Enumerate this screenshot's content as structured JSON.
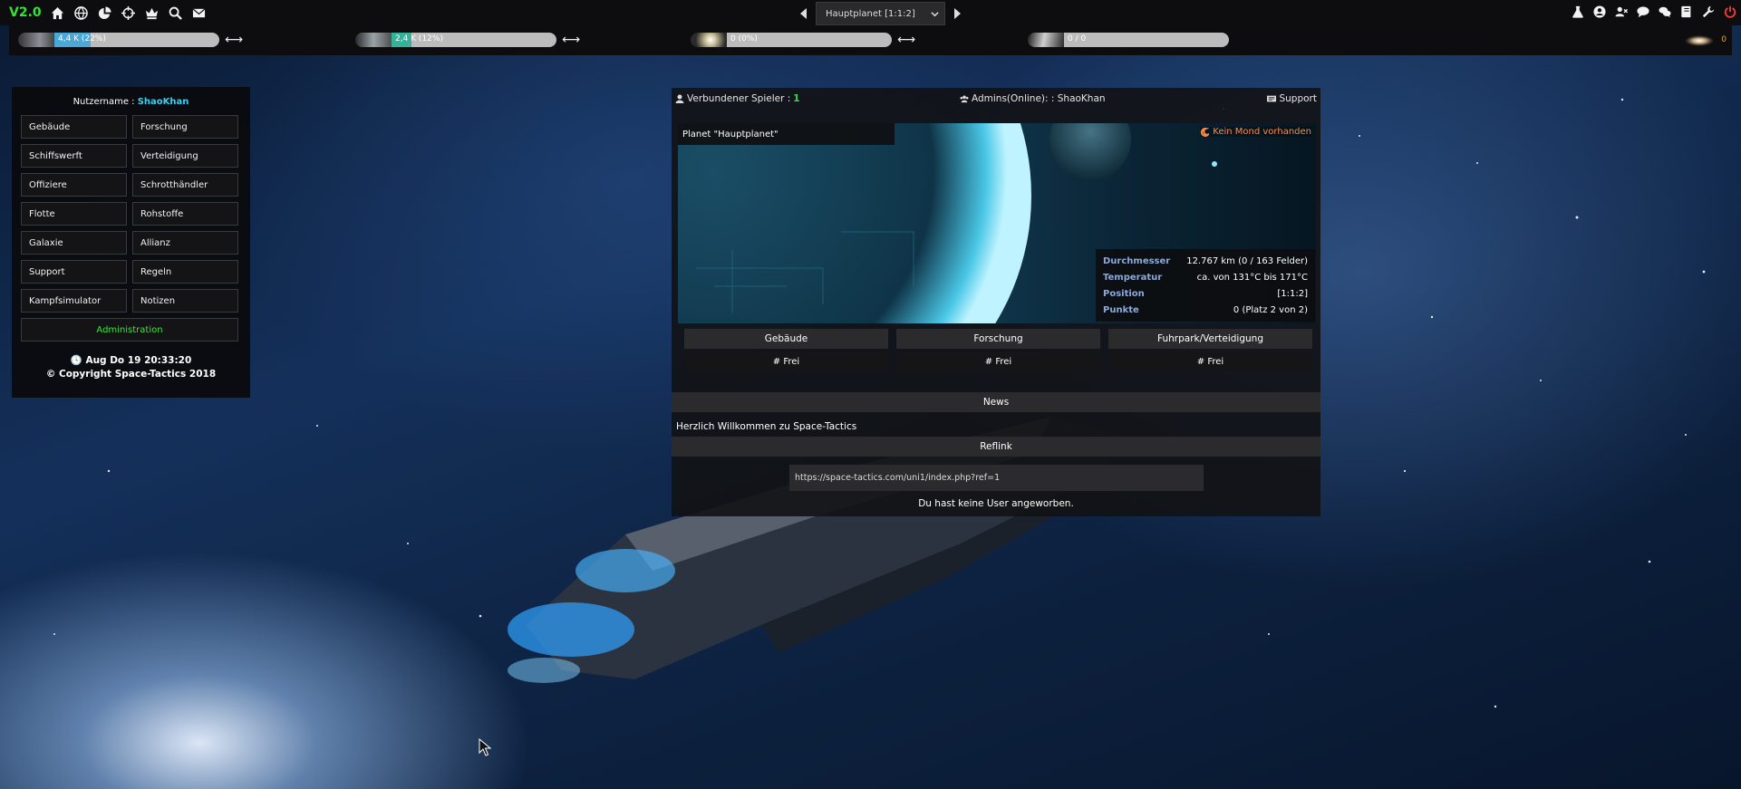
{
  "topbar": {
    "version": "V2.0",
    "left_icons": [
      "home-icon",
      "globe-icon",
      "pie-chart-icon",
      "crosshair-icon",
      "crown-icon",
      "search-icon",
      "envelope-icon"
    ],
    "planet_selector": "Hauptplanet [1:1:2]",
    "right_icons": [
      "flask-icon",
      "user-circle-icon",
      "user-remove-icon",
      "comment-icon",
      "comments-icon",
      "book-icon",
      "wrench-icon",
      "power-icon"
    ]
  },
  "resources": [
    {
      "label": "4,4 K (22%)",
      "fill": 0.22,
      "color": "#4aa8d6"
    },
    {
      "label": "2,4 K (12%)",
      "fill": 0.12,
      "color": "#35b39a"
    },
    {
      "label": "0 (0%)",
      "fill": 0.0,
      "color": "#cccccc"
    },
    {
      "label": "0  / 0",
      "fill": 0.0,
      "color": "#cccccc"
    }
  ],
  "galaxy_value": "0",
  "left_menu": {
    "username_label": "Nutzername :",
    "username": "ShaoKhan",
    "items": [
      "Gebäude",
      "Forschung",
      "Schiffswerft",
      "Verteidigung",
      "Offiziere",
      "Schrotthändler",
      "Flotte",
      "Rohstoffe",
      "Galaxie",
      "Allianz",
      "Support",
      "Regeln",
      "Kampfsimulator",
      "Notizen"
    ],
    "admin": "Administration",
    "datetime": "Aug Do 19 20:33:20",
    "copyright": "© Copyright Space-Tactics 2018"
  },
  "main": {
    "connected_label": "Verbundener Spieler :",
    "connected_count": "1",
    "admins_label": "Admins(Online): : ShaoKhan",
    "support_label": "Support",
    "planet_title": "Planet \"Hauptplanet\"",
    "moon_text": "Kein Mond vorhanden",
    "info": [
      {
        "key": "Durchmesser",
        "value": "12.767 km (0 / 163 Felder)"
      },
      {
        "key": "Temperatur",
        "value": "ca. von 131°C bis 171°C"
      },
      {
        "key": "Position",
        "value": "[1:1:2]"
      },
      {
        "key": "Punkte",
        "value": "0 (Platz 2 von 2)"
      }
    ],
    "queues": [
      {
        "title": "Gebäude",
        "status": "# Frei"
      },
      {
        "title": "Forschung",
        "status": "# Frei"
      },
      {
        "title": "Fuhrpark/Verteidigung",
        "status": "# Frei"
      }
    ],
    "news_header": "News",
    "news_text": "Herzlich Willkommen zu Space-Tactics",
    "reflink_header": "Reflink",
    "reflink_url": "https://space-tactics.com/uni1/index.php?ref=1",
    "reflink_note": "Du hast keine User angeworben."
  }
}
